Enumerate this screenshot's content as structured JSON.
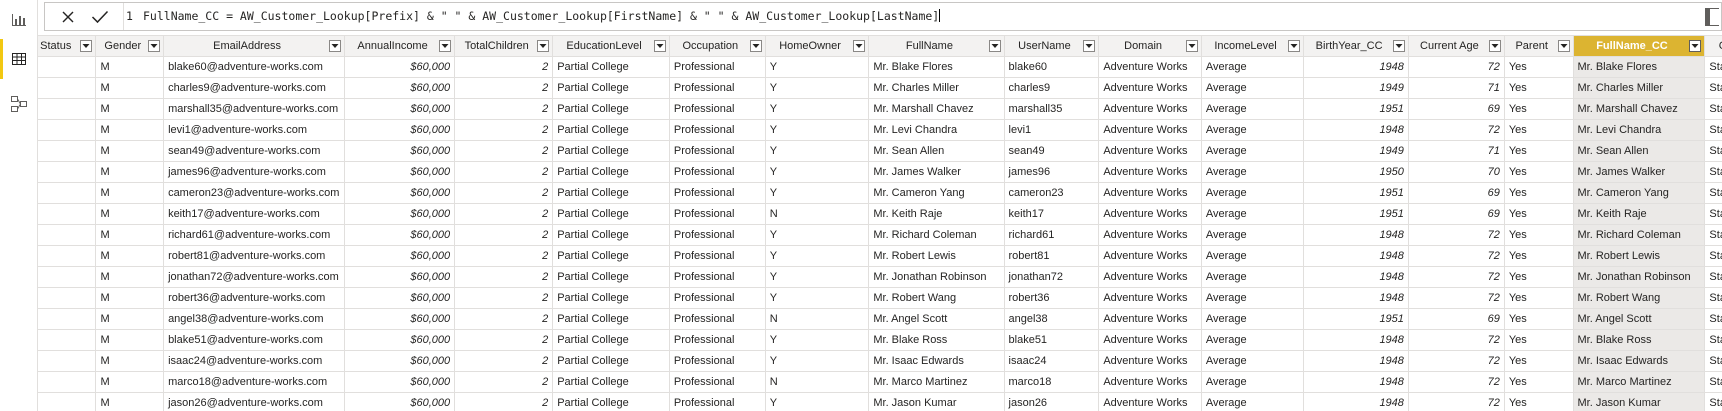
{
  "formula": {
    "line_number": "1",
    "text": "FullName_CC = AW_Customer_Lookup[Prefix] & \" \" & AW_Customer_Lookup[FirstName] & \" \" & AW_Customer_Lookup[LastName]"
  },
  "views": [
    "report-view",
    "data-view",
    "model-view"
  ],
  "columns": [
    {
      "key": "status",
      "label": "Status",
      "width": 61,
      "align": "left"
    },
    {
      "key": "gender",
      "label": "Gender",
      "width": 62,
      "align": "left"
    },
    {
      "key": "email",
      "label": "EmailAddress",
      "width": 166,
      "align": "left"
    },
    {
      "key": "income",
      "label": "AnnualIncome",
      "width": 101,
      "align": "right"
    },
    {
      "key": "children",
      "label": "TotalChildren",
      "width": 90,
      "align": "right"
    },
    {
      "key": "education",
      "label": "EducationLevel",
      "width": 107,
      "align": "left"
    },
    {
      "key": "occupation",
      "label": "Occupation",
      "width": 88,
      "align": "left"
    },
    {
      "key": "homeowner",
      "label": "HomeOwner",
      "width": 95,
      "align": "left"
    },
    {
      "key": "fullname",
      "label": "FullName",
      "width": 124,
      "align": "left"
    },
    {
      "key": "username",
      "label": "UserName",
      "width": 87,
      "align": "left"
    },
    {
      "key": "domain",
      "label": "Domain",
      "width": 94,
      "align": "left"
    },
    {
      "key": "incomelevel",
      "label": "IncomeLevel",
      "width": 94,
      "align": "left"
    },
    {
      "key": "birthyear",
      "label": "BirthYear_CC",
      "width": 96,
      "align": "right"
    },
    {
      "key": "age",
      "label": "Current Age",
      "width": 88,
      "align": "right"
    },
    {
      "key": "parent",
      "label": "Parent",
      "width": 63,
      "align": "left"
    },
    {
      "key": "fullname_cc",
      "label": "FullName_CC",
      "width": 121,
      "align": "left",
      "selected": true
    },
    {
      "key": "priority",
      "label": "Customer Priority",
      "width": 116,
      "align": "left"
    }
  ],
  "rows": [
    [
      "",
      "M",
      "blake60@adventure-works.com",
      "$60,000",
      "2",
      "Partial College",
      "Professional",
      "Y",
      "Mr. Blake Flores",
      "blake60",
      "Adventure Works",
      "Average",
      "1948",
      "72",
      "Yes",
      "Mr. Blake Flores",
      "Standard"
    ],
    [
      "",
      "M",
      "charles9@adventure-works.com",
      "$60,000",
      "2",
      "Partial College",
      "Professional",
      "Y",
      "Mr. Charles Miller",
      "charles9",
      "Adventure Works",
      "Average",
      "1949",
      "71",
      "Yes",
      "Mr. Charles Miller",
      "Standard"
    ],
    [
      "",
      "M",
      "marshall35@adventure-works.com",
      "$60,000",
      "2",
      "Partial College",
      "Professional",
      "Y",
      "Mr. Marshall Chavez",
      "marshall35",
      "Adventure Works",
      "Average",
      "1951",
      "69",
      "Yes",
      "Mr. Marshall Chavez",
      "Standard"
    ],
    [
      "",
      "M",
      "levi1@adventure-works.com",
      "$60,000",
      "2",
      "Partial College",
      "Professional",
      "Y",
      "Mr. Levi Chandra",
      "levi1",
      "Adventure Works",
      "Average",
      "1948",
      "72",
      "Yes",
      "Mr. Levi Chandra",
      "Standard"
    ],
    [
      "",
      "M",
      "sean49@adventure-works.com",
      "$60,000",
      "2",
      "Partial College",
      "Professional",
      "Y",
      "Mr. Sean Allen",
      "sean49",
      "Adventure Works",
      "Average",
      "1949",
      "71",
      "Yes",
      "Mr. Sean Allen",
      "Standard"
    ],
    [
      "",
      "M",
      "james96@adventure-works.com",
      "$60,000",
      "2",
      "Partial College",
      "Professional",
      "Y",
      "Mr. James Walker",
      "james96",
      "Adventure Works",
      "Average",
      "1950",
      "70",
      "Yes",
      "Mr. James Walker",
      "Standard"
    ],
    [
      "",
      "M",
      "cameron23@adventure-works.com",
      "$60,000",
      "2",
      "Partial College",
      "Professional",
      "Y",
      "Mr. Cameron Yang",
      "cameron23",
      "Adventure Works",
      "Average",
      "1951",
      "69",
      "Yes",
      "Mr. Cameron Yang",
      "Standard"
    ],
    [
      "",
      "M",
      "keith17@adventure-works.com",
      "$60,000",
      "2",
      "Partial College",
      "Professional",
      "N",
      "Mr. Keith Raje",
      "keith17",
      "Adventure Works",
      "Average",
      "1951",
      "69",
      "Yes",
      "Mr. Keith Raje",
      "Standard"
    ],
    [
      "",
      "M",
      "richard61@adventure-works.com",
      "$60,000",
      "2",
      "Partial College",
      "Professional",
      "Y",
      "Mr. Richard Coleman",
      "richard61",
      "Adventure Works",
      "Average",
      "1948",
      "72",
      "Yes",
      "Mr. Richard Coleman",
      "Standard"
    ],
    [
      "",
      "M",
      "robert81@adventure-works.com",
      "$60,000",
      "2",
      "Partial College",
      "Professional",
      "Y",
      "Mr. Robert Lewis",
      "robert81",
      "Adventure Works",
      "Average",
      "1948",
      "72",
      "Yes",
      "Mr. Robert Lewis",
      "Standard"
    ],
    [
      "",
      "M",
      "jonathan72@adventure-works.com",
      "$60,000",
      "2",
      "Partial College",
      "Professional",
      "Y",
      "Mr. Jonathan Robinson",
      "jonathan72",
      "Adventure Works",
      "Average",
      "1948",
      "72",
      "Yes",
      "Mr. Jonathan Robinson",
      "Standard"
    ],
    [
      "",
      "M",
      "robert36@adventure-works.com",
      "$60,000",
      "2",
      "Partial College",
      "Professional",
      "Y",
      "Mr. Robert Wang",
      "robert36",
      "Adventure Works",
      "Average",
      "1948",
      "72",
      "Yes",
      "Mr. Robert Wang",
      "Standard"
    ],
    [
      "",
      "M",
      "angel38@adventure-works.com",
      "$60,000",
      "2",
      "Partial College",
      "Professional",
      "N",
      "Mr. Angel Scott",
      "angel38",
      "Adventure Works",
      "Average",
      "1951",
      "69",
      "Yes",
      "Mr. Angel Scott",
      "Standard"
    ],
    [
      "",
      "M",
      "blake51@adventure-works.com",
      "$60,000",
      "2",
      "Partial College",
      "Professional",
      "Y",
      "Mr. Blake Ross",
      "blake51",
      "Adventure Works",
      "Average",
      "1948",
      "72",
      "Yes",
      "Mr. Blake Ross",
      "Standard"
    ],
    [
      "",
      "M",
      "isaac24@adventure-works.com",
      "$60,000",
      "2",
      "Partial College",
      "Professional",
      "Y",
      "Mr. Isaac Edwards",
      "isaac24",
      "Adventure Works",
      "Average",
      "1948",
      "72",
      "Yes",
      "Mr. Isaac Edwards",
      "Standard"
    ],
    [
      "",
      "M",
      "marco18@adventure-works.com",
      "$60,000",
      "2",
      "Partial College",
      "Professional",
      "N",
      "Mr. Marco Martinez",
      "marco18",
      "Adventure Works",
      "Average",
      "1948",
      "72",
      "Yes",
      "Mr. Marco Martinez",
      "Standard"
    ],
    [
      "",
      "M",
      "jason26@adventure-works.com",
      "$60,000",
      "2",
      "Partial College",
      "Professional",
      "Y",
      "Mr. Jason Kumar",
      "jason26",
      "Adventure Works",
      "Average",
      "1948",
      "72",
      "Yes",
      "Mr. Jason Kumar",
      "Standard"
    ]
  ],
  "colors": {
    "accent": "#f2c811",
    "selected_header": "#dcb431",
    "selected_cell": "#ebe9e7"
  }
}
